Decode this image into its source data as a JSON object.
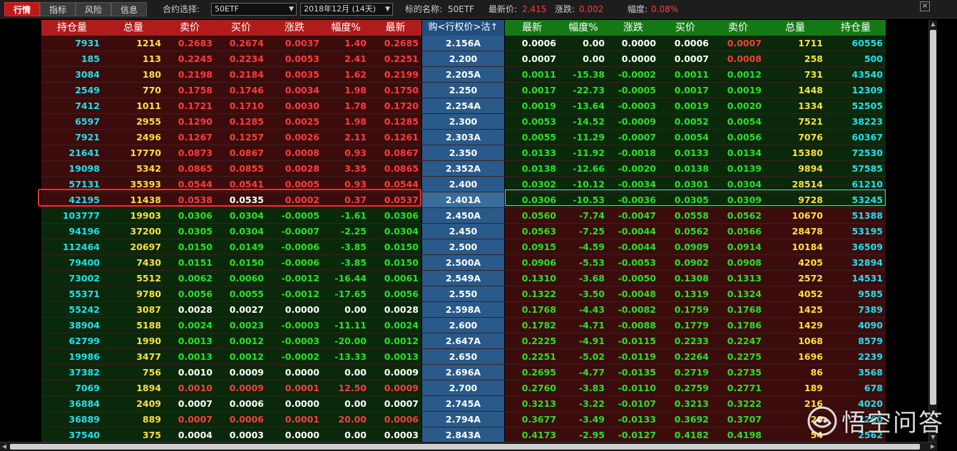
{
  "toolbar": {
    "tabs": [
      {
        "label": "行情",
        "active": true
      },
      {
        "label": "指标",
        "active": false
      },
      {
        "label": "风险",
        "active": false
      },
      {
        "label": "信息",
        "active": false
      }
    ],
    "contract_label": "合约选择:",
    "contract_value": "50ETF",
    "month_value": "2018年12月 (14天)",
    "underlying_label": "标的名称:",
    "underlying_value": "50ETF",
    "last_label": "最新价:",
    "last_value": "2.415",
    "change_label": "涨跌:",
    "change_value": "0.002",
    "pct_label": "幅度:",
    "pct_value": "0.08%",
    "close_glyph": "×"
  },
  "headers": {
    "call": [
      "持仓量",
      "总量",
      "卖价",
      "买价",
      "涨跌",
      "幅度%",
      "最新"
    ],
    "strike": "购<行权价>沽↑",
    "put": [
      "最新",
      "幅度%",
      "涨跌",
      "买价",
      "卖价",
      "总量",
      "持仓量"
    ]
  },
  "colors": {
    "call_itm_bg": "#3c0c0c",
    "put_itm_bg": "#0a280a",
    "call_otm_bg": "#0a280a",
    "put_otm_bg": "#3c0c0c",
    "strike_bg": "#2a5a8a",
    "header_call_bg": "#b01c1c",
    "header_put_bg": "#157a15",
    "header_strike_bg": "#1f4f7f"
  },
  "rows": [
    {
      "strike": "2.156A",
      "call": [
        "7931",
        "1214",
        "0.2683",
        "0.2674",
        "0.0037",
        "1.40",
        "0.2685"
      ],
      "put": [
        "0.0006",
        "0.00",
        "0.0000",
        "0.0006",
        "0.0007",
        "1711",
        "60556"
      ]
    },
    {
      "strike": "2.200",
      "call": [
        "185",
        "113",
        "0.2245",
        "0.2234",
        "0.0053",
        "2.41",
        "0.2251"
      ],
      "put": [
        "0.0007",
        "0.00",
        "0.0000",
        "0.0007",
        "0.0008",
        "258",
        "500"
      ]
    },
    {
      "strike": "2.205A",
      "call": [
        "3084",
        "180",
        "0.2198",
        "0.2184",
        "0.0035",
        "1.62",
        "0.2199"
      ],
      "put": [
        "0.0011",
        "-15.38",
        "-0.0002",
        "0.0011",
        "0.0012",
        "731",
        "43540"
      ]
    },
    {
      "strike": "2.250",
      "call": [
        "2549",
        "770",
        "0.1758",
        "0.1746",
        "0.0034",
        "1.98",
        "0.1750"
      ],
      "put": [
        "0.0017",
        "-22.73",
        "-0.0005",
        "0.0017",
        "0.0019",
        "1448",
        "12309"
      ]
    },
    {
      "strike": "2.254A",
      "call": [
        "7412",
        "1011",
        "0.1721",
        "0.1710",
        "0.0030",
        "1.78",
        "0.1720"
      ],
      "put": [
        "0.0019",
        "-13.64",
        "-0.0003",
        "0.0019",
        "0.0020",
        "1334",
        "52505"
      ]
    },
    {
      "strike": "2.300",
      "call": [
        "6597",
        "2955",
        "0.1290",
        "0.1285",
        "0.0025",
        "1.98",
        "0.1285"
      ],
      "put": [
        "0.0053",
        "-14.52",
        "-0.0009",
        "0.0052",
        "0.0054",
        "7521",
        "38223"
      ]
    },
    {
      "strike": "2.303A",
      "call": [
        "7921",
        "2496",
        "0.1267",
        "0.1257",
        "0.0026",
        "2.11",
        "0.1261"
      ],
      "put": [
        "0.0055",
        "-11.29",
        "-0.0007",
        "0.0054",
        "0.0056",
        "7076",
        "60367"
      ]
    },
    {
      "strike": "2.350",
      "call": [
        "21641",
        "17770",
        "0.0873",
        "0.0867",
        "0.0008",
        "0.93",
        "0.0867"
      ],
      "put": [
        "0.0133",
        "-11.92",
        "-0.0018",
        "0.0133",
        "0.0134",
        "15380",
        "72530"
      ]
    },
    {
      "strike": "2.352A",
      "call": [
        "19098",
        "5342",
        "0.0865",
        "0.0855",
        "0.0028",
        "3.35",
        "0.0865"
      ],
      "put": [
        "0.0138",
        "-12.66",
        "-0.0020",
        "0.0138",
        "0.0139",
        "9894",
        "57585"
      ]
    },
    {
      "strike": "2.400",
      "call": [
        "57131",
        "35393",
        "0.0544",
        "0.0541",
        "0.0005",
        "0.93",
        "0.0544"
      ],
      "put": [
        "0.0302",
        "-10.12",
        "-0.0034",
        "0.0301",
        "0.0304",
        "28514",
        "61210"
      ]
    },
    {
      "strike": "2.401A",
      "call": [
        "42195",
        "11438",
        "0.0538",
        "0.0535",
        "0.0002",
        "0.37",
        "0.0537"
      ],
      "put": [
        "0.0306",
        "-10.53",
        "-0.0036",
        "0.0305",
        "0.0309",
        "9728",
        "53245"
      ]
    },
    {
      "strike": "2.450A",
      "call": [
        "103777",
        "19903",
        "0.0306",
        "0.0304",
        "-0.0005",
        "-1.61",
        "0.0306"
      ],
      "put": [
        "0.0560",
        "-7.74",
        "-0.0047",
        "0.0558",
        "0.0562",
        "10670",
        "51388"
      ]
    },
    {
      "strike": "2.450",
      "call": [
        "94196",
        "37200",
        "0.0305",
        "0.0304",
        "-0.0007",
        "-2.25",
        "0.0304"
      ],
      "put": [
        "0.0563",
        "-7.25",
        "-0.0044",
        "0.0562",
        "0.0566",
        "28478",
        "53195"
      ]
    },
    {
      "strike": "2.500",
      "call": [
        "112464",
        "20697",
        "0.0150",
        "0.0149",
        "-0.0006",
        "-3.85",
        "0.0150"
      ],
      "put": [
        "0.0915",
        "-4.59",
        "-0.0044",
        "0.0909",
        "0.0914",
        "10184",
        "36509"
      ]
    },
    {
      "strike": "2.500A",
      "call": [
        "79400",
        "7430",
        "0.0151",
        "0.0150",
        "-0.0006",
        "-3.85",
        "0.0150"
      ],
      "put": [
        "0.0906",
        "-5.53",
        "-0.0053",
        "0.0902",
        "0.0908",
        "4205",
        "32894"
      ]
    },
    {
      "strike": "2.549A",
      "call": [
        "73002",
        "5512",
        "0.0062",
        "0.0060",
        "-0.0012",
        "-16.44",
        "0.0061"
      ],
      "put": [
        "0.1310",
        "-3.68",
        "-0.0050",
        "0.1308",
        "0.1313",
        "2572",
        "14531"
      ]
    },
    {
      "strike": "2.550",
      "call": [
        "55371",
        "9780",
        "0.0056",
        "0.0055",
        "-0.0012",
        "-17.65",
        "0.0056"
      ],
      "put": [
        "0.1322",
        "-3.50",
        "-0.0048",
        "0.1319",
        "0.1324",
        "4052",
        "9585"
      ]
    },
    {
      "strike": "2.598A",
      "call": [
        "55242",
        "3087",
        "0.0028",
        "0.0027",
        "0.0000",
        "0.00",
        "0.0028"
      ],
      "put": [
        "0.1768",
        "-4.43",
        "-0.0082",
        "0.1759",
        "0.1768",
        "1425",
        "7389"
      ]
    },
    {
      "strike": "2.600",
      "call": [
        "38904",
        "5188",
        "0.0024",
        "0.0023",
        "-0.0003",
        "-11.11",
        "0.0024"
      ],
      "put": [
        "0.1782",
        "-4.71",
        "-0.0088",
        "0.1779",
        "0.1786",
        "1429",
        "4090"
      ]
    },
    {
      "strike": "2.647A",
      "call": [
        "62799",
        "1990",
        "0.0013",
        "0.0012",
        "-0.0003",
        "-20.00",
        "0.0012"
      ],
      "put": [
        "0.2225",
        "-4.91",
        "-0.0115",
        "0.2233",
        "0.2247",
        "1068",
        "8579"
      ]
    },
    {
      "strike": "2.650",
      "call": [
        "19986",
        "3477",
        "0.0013",
        "0.0012",
        "-0.0002",
        "-13.33",
        "0.0013"
      ],
      "put": [
        "0.2251",
        "-5.02",
        "-0.0119",
        "0.2264",
        "0.2275",
        "1696",
        "2239"
      ]
    },
    {
      "strike": "2.696A",
      "call": [
        "37382",
        "756",
        "0.0010",
        "0.0009",
        "0.0000",
        "0.00",
        "0.0009"
      ],
      "put": [
        "0.2695",
        "-4.77",
        "-0.0135",
        "0.2719",
        "0.2735",
        "86",
        "3568"
      ]
    },
    {
      "strike": "2.700",
      "call": [
        "7069",
        "1894",
        "0.0010",
        "0.0009",
        "0.0001",
        "12.50",
        "0.0009"
      ],
      "put": [
        "0.2760",
        "-3.83",
        "-0.0110",
        "0.2759",
        "0.2771",
        "189",
        "678"
      ]
    },
    {
      "strike": "2.745A",
      "call": [
        "36884",
        "2409",
        "0.0007",
        "0.0006",
        "0.0000",
        "0.00",
        "0.0007"
      ],
      "put": [
        "0.3213",
        "-3.22",
        "-0.0107",
        "0.3213",
        "0.3222",
        "216",
        "4020"
      ]
    },
    {
      "strike": "2.794A",
      "call": [
        "36889",
        "889",
        "0.0007",
        "0.0006",
        "0.0001",
        "20.00",
        "0.0006"
      ],
      "put": [
        "0.3677",
        "-3.49",
        "-0.0133",
        "0.3692",
        "0.3707",
        "20",
        "2260"
      ]
    },
    {
      "strike": "2.843A",
      "call": [
        "37540",
        "375",
        "0.0004",
        "0.0003",
        "0.0000",
        "0.00",
        "0.0003"
      ],
      "put": [
        "0.4173",
        "-2.95",
        "-0.0127",
        "0.4182",
        "0.4198",
        "54",
        "2562"
      ]
    }
  ],
  "selected_strike": "2.401A",
  "watermark": {
    "text": "悟空问答",
    "icon": "wukong-logo-icon"
  }
}
